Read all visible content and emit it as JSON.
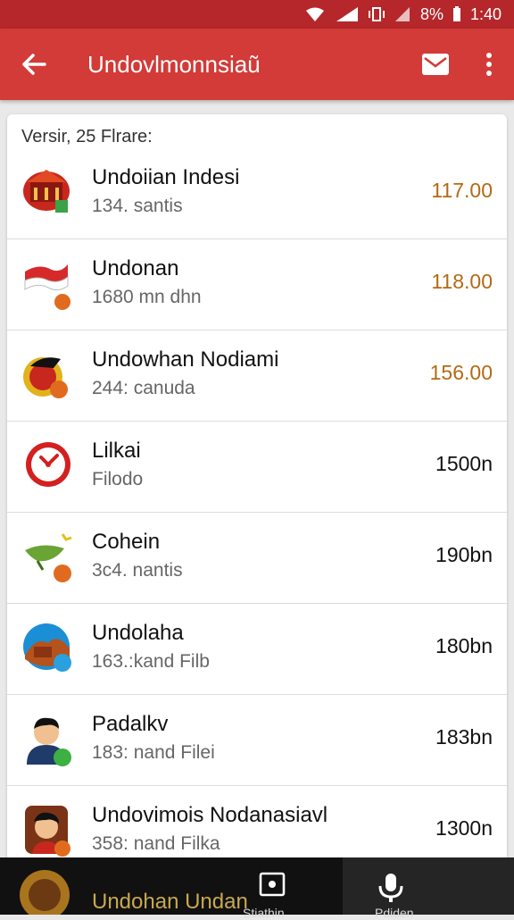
{
  "status_bar": {
    "battery_text": "8%",
    "time": "1:40"
  },
  "app_bar": {
    "title": "Undovlmonnsiaũ"
  },
  "list": {
    "header": "Versir, 25 Flrare:",
    "items": [
      {
        "name": "Undoiian Indesi",
        "sub": "134. santis",
        "amount": "117.00",
        "amount_color": "#b36a12",
        "icon": "temple-icon"
      },
      {
        "name": "Undonan",
        "sub": "1680 mn dhn",
        "amount": "118.00",
        "amount_color": "#b36a12",
        "icon": "flag-icon"
      },
      {
        "name": "Undowhan Nodiami",
        "sub": "244: canuda",
        "amount": "156.00",
        "amount_color": "#b36a12",
        "icon": "bird-icon"
      },
      {
        "name": "Lilkai",
        "sub": "Filodo",
        "amount": "1500n",
        "amount_color": "#111111",
        "icon": "clock-icon"
      },
      {
        "name": "Cohein",
        "sub": "3c4. nantis",
        "amount": "190bn",
        "amount_color": "#111111",
        "icon": "leaf-bird-icon"
      },
      {
        "name": "Undolaha",
        "sub": "163.:kand Filb",
        "amount": "180bn",
        "amount_color": "#111111",
        "icon": "landscape-icon"
      },
      {
        "name": "Padalkv",
        "sub": "183: nand Filei",
        "amount": "183bn",
        "amount_color": "#111111",
        "icon": "person-icon"
      },
      {
        "name": "Undovimois Nodanasiavl",
        "sub": "358: nand Filka",
        "amount": "1300n",
        "amount_color": "#111111",
        "icon": "portrait-icon"
      }
    ]
  },
  "peek_item": {
    "text": "Undohan Undan"
  },
  "bottom_nav": {
    "tab1_label": "Stiathin",
    "tab2_label": "Pdiden"
  },
  "colors": {
    "status_bar": "#b5272b",
    "app_bar": "#d23b38",
    "amount_accent": "#b36a12"
  }
}
